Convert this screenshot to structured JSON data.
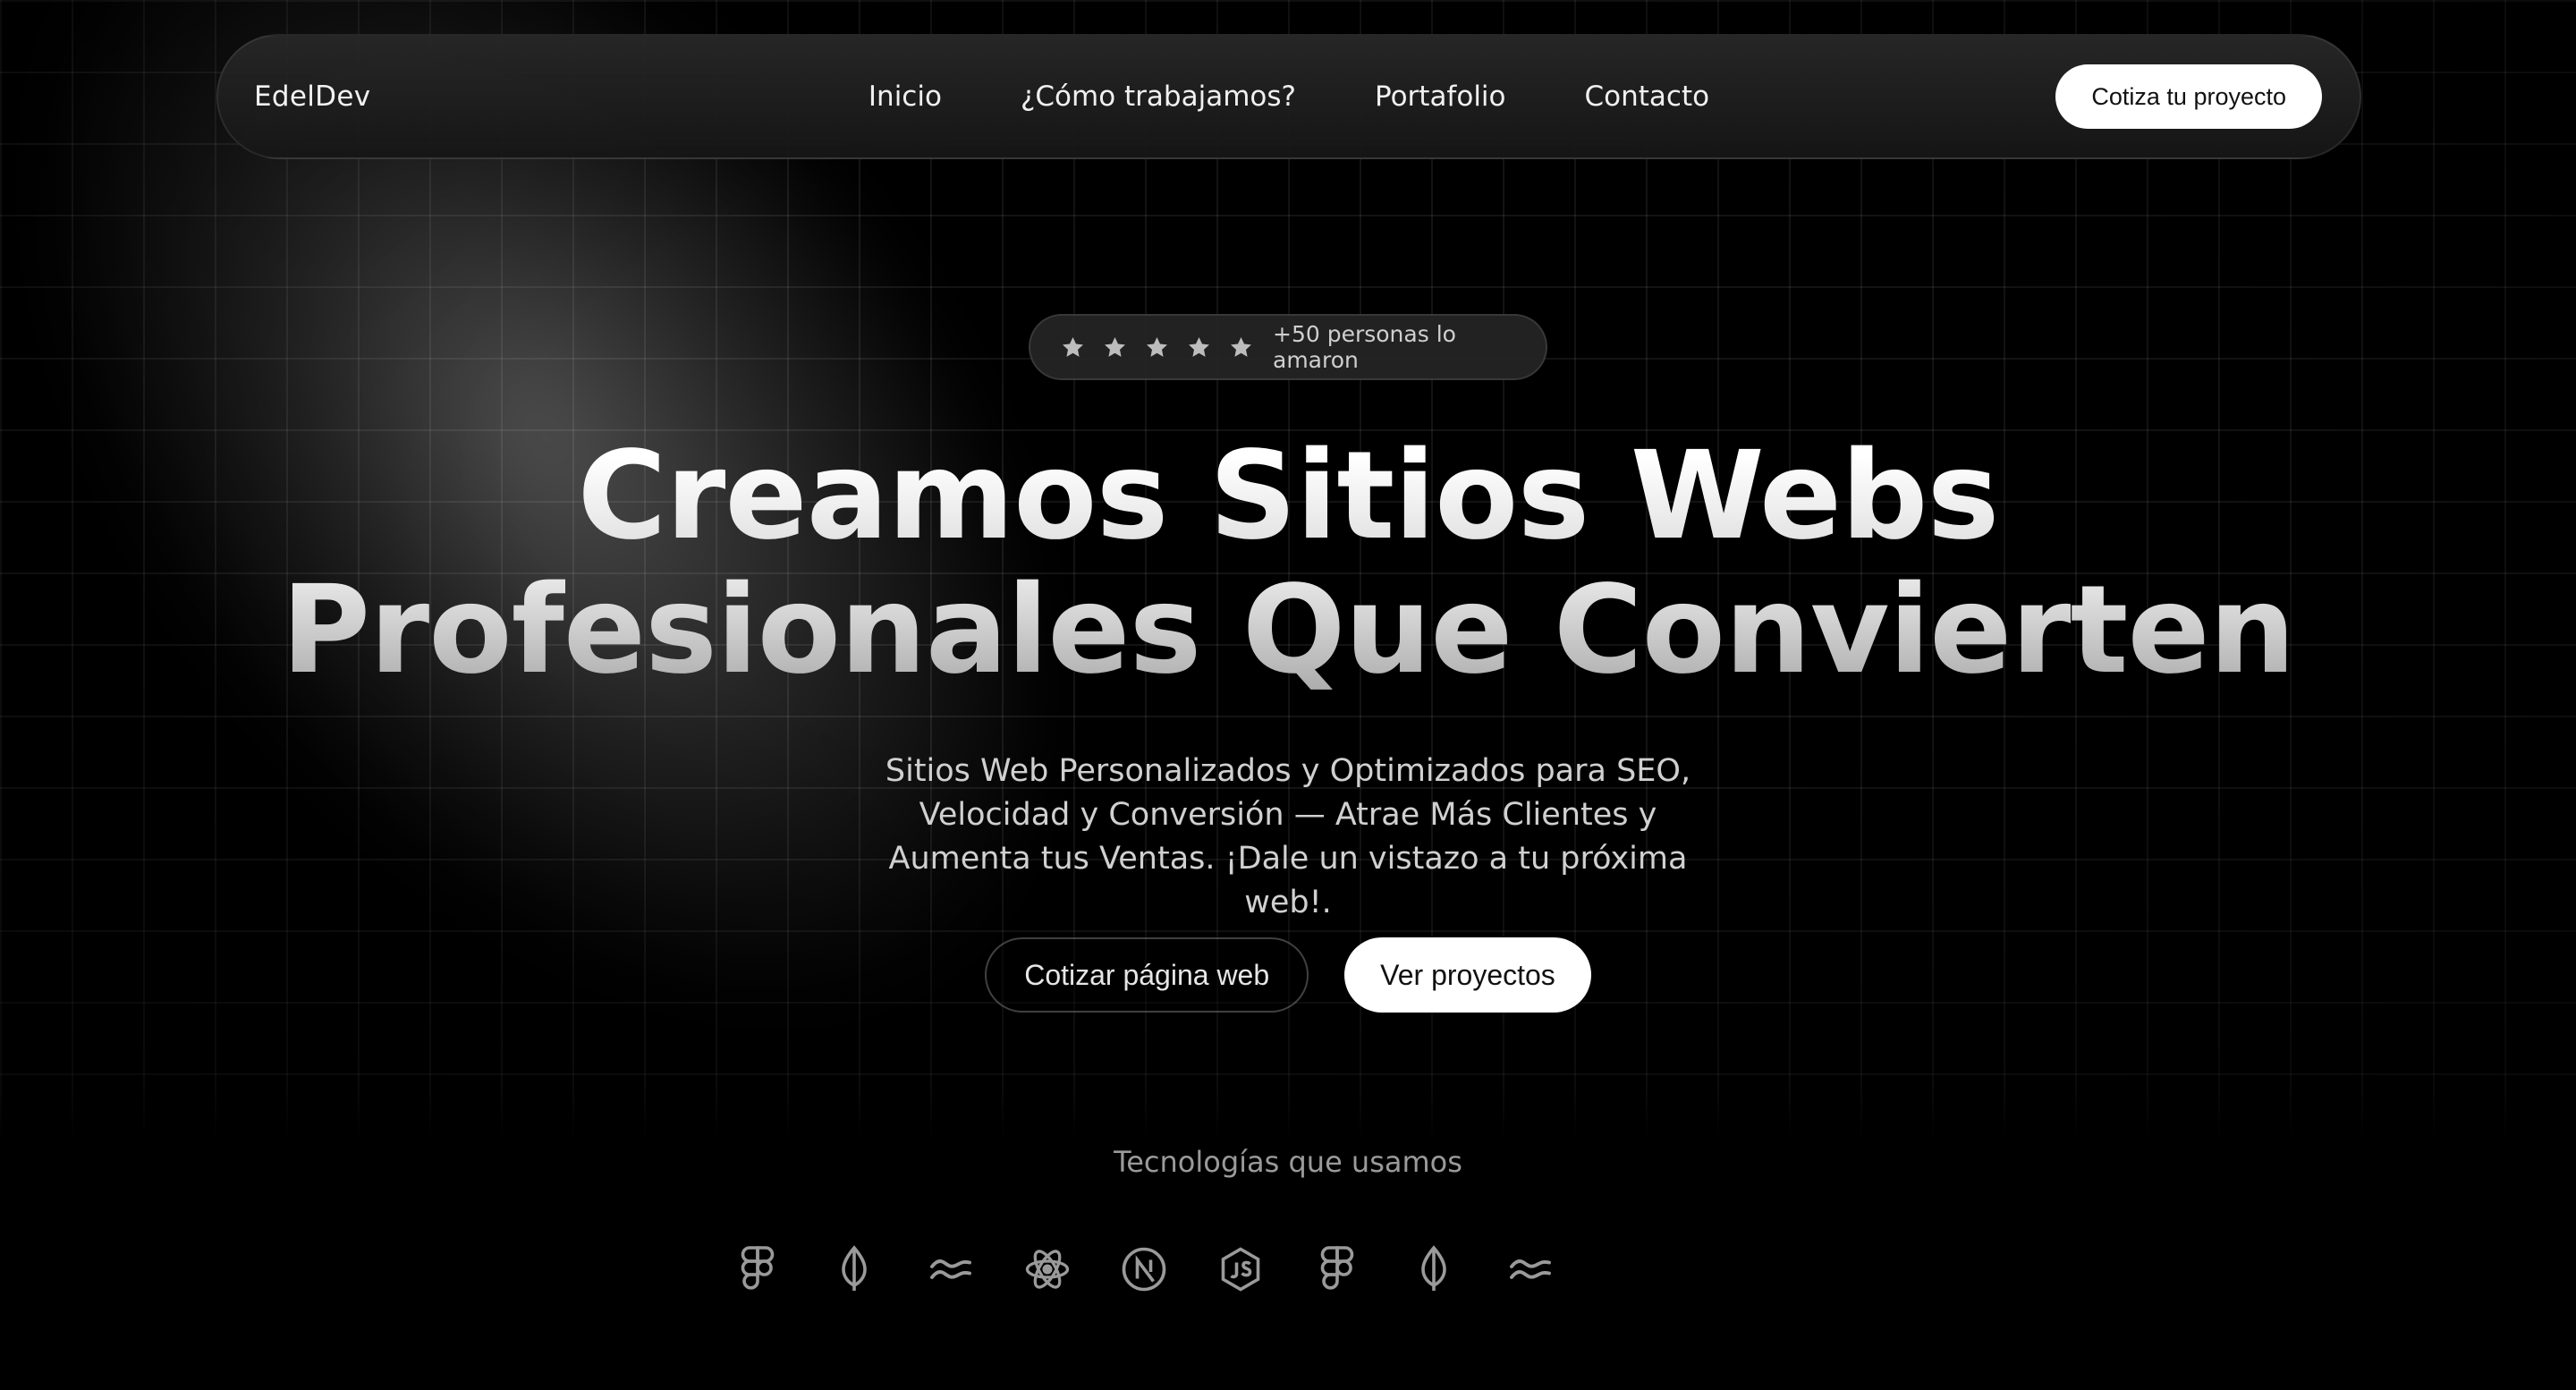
{
  "navbar": {
    "brand": "EdelDev",
    "links": [
      "Inicio",
      "¿Cómo trabajamos?",
      "Portafolio",
      "Contacto"
    ],
    "cta": "Cotiza tu proyecto"
  },
  "rating": {
    "stars": 5,
    "text": "+50 personas lo amaron"
  },
  "hero": {
    "headline_line1": "Creamos Sitios Webs",
    "headline_line2": "Profesionales Que Convierten",
    "subtitle_line1": "Sitios Web Personalizados y Optimizados para SEO,",
    "subtitle_line2": "Velocidad y Conversión — Atrae Más Clientes y",
    "subtitle_line3": "Aumenta tus Ventas. ¡Dale un vistazo a tu próxima web!.",
    "primary_button": "Cotizar página web",
    "secondary_button": "Ver proyectos"
  },
  "technologies": {
    "title": "Tecnologías que usamos",
    "icons": [
      "figma-icon",
      "mongodb-icon",
      "tailwind-icon",
      "react-icon",
      "nextjs-icon",
      "nodejs-icon",
      "figma-icon",
      "mongodb-icon",
      "tailwind-icon"
    ]
  },
  "colors": {
    "background": "#000000",
    "accent": "#ffffff",
    "muted_text": "#9a9a9a"
  }
}
